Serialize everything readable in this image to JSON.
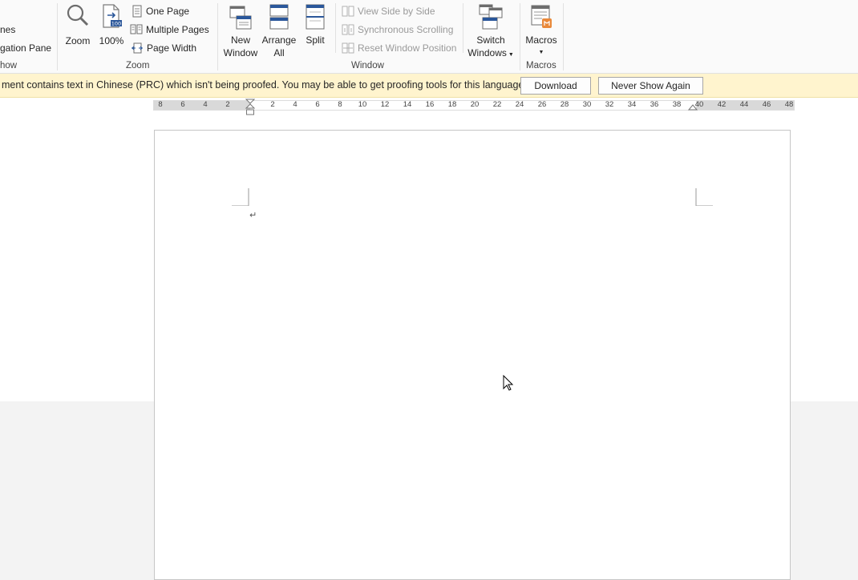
{
  "ribbon": {
    "show_group": {
      "items": [
        "nes",
        "gation Pane"
      ],
      "label": "how"
    },
    "zoom_group": {
      "zoom": "Zoom",
      "hundred": "100%",
      "one_page": "One Page",
      "multiple_pages": "Multiple Pages",
      "page_width": "Page Width",
      "label": "Zoom"
    },
    "window_group": {
      "new_window": [
        "New",
        "Window"
      ],
      "arrange_all": [
        "Arrange",
        "All"
      ],
      "split": "Split",
      "view_side_by_side": "View Side by Side",
      "synchronous_scrolling": "Synchronous Scrolling",
      "reset_window_position": "Reset Window Position",
      "switch_windows": [
        "Switch",
        "Windows"
      ],
      "label": "Window"
    },
    "macros_group": {
      "macros": "Macros",
      "label": "Macros"
    }
  },
  "infobar": {
    "message": "ment contains text in Chinese (PRC) which isn't being proofed. You may be able to get proofing tools for this language.",
    "download": "Download",
    "never_show": "Never Show Again"
  },
  "ruler": {
    "left_ticks": [
      "8",
      "6",
      "4",
      "2"
    ],
    "right_ticks": [
      "2",
      "4",
      "6",
      "8",
      "10",
      "12",
      "14",
      "16",
      "18",
      "20",
      "22",
      "24",
      "26",
      "28",
      "30",
      "32",
      "34",
      "36",
      "38",
      "40",
      "42",
      "44",
      "46",
      "48"
    ]
  },
  "document": {
    "paragraph_mark": "↵"
  },
  "colors": {
    "accent_blue": "#2b579a",
    "infobar_bg": "#fff4ce",
    "macros_orange": "#e9893b"
  }
}
